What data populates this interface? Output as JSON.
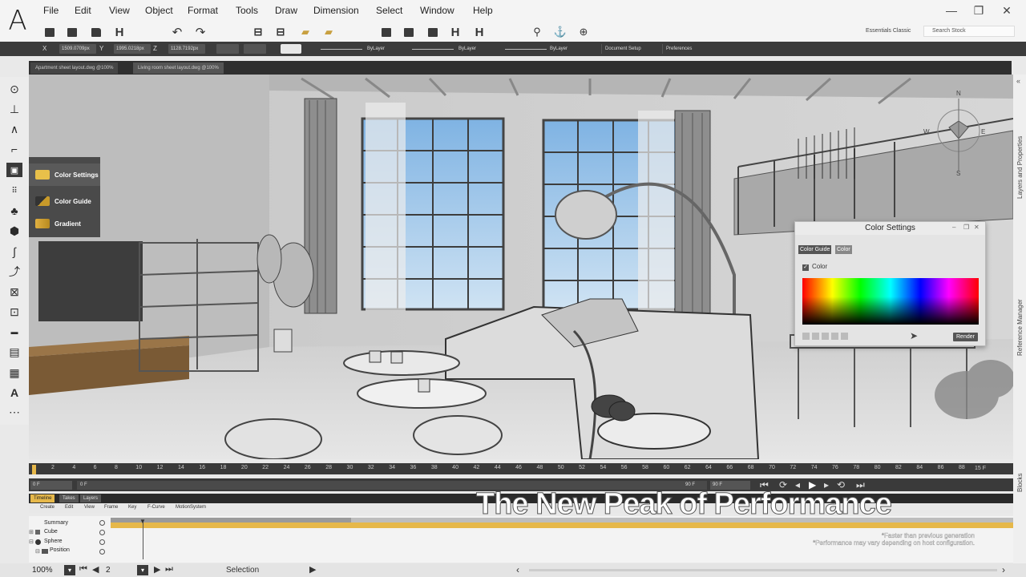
{
  "app": {
    "logo": "A"
  },
  "menu": [
    "File",
    "Edit",
    "View",
    "Object",
    "Format",
    "Tools",
    "Draw",
    "Dimension",
    "Select",
    "Window",
    "Help"
  ],
  "window_controls": {
    "minimize": "—",
    "restore": "❐",
    "close": "✕"
  },
  "toolbar": {
    "workspace": "Essentials Classic",
    "search_placeholder": "Search Stock"
  },
  "props": {
    "x_label": "X",
    "x_value": "1509.0709px",
    "y_label": "Y",
    "y_value": "1995.0218px",
    "z_label": "Z",
    "z_value": "1128.7192px",
    "layer1": "ByLayer",
    "layer2": "ByLayer",
    "layer3": "ByLayer",
    "doc_setup": "Document Setup",
    "preferences": "Preferences"
  },
  "tabs": [
    "Apartment sheet layout.dwg @100%",
    "Living room sheet layout.dwg @100%"
  ],
  "flyout": [
    {
      "label": "Color Settings",
      "color": "#e8c04a"
    },
    {
      "label": "Color Guide",
      "color": "#c89a2a"
    },
    {
      "label": "Gradient",
      "color": "#e0b040"
    }
  ],
  "right_tabs": {
    "layers": "Layers and Properties",
    "reference": "Reference Manager",
    "blocks": "Blocks"
  },
  "color_panel": {
    "title": "Color Settings",
    "tab1": "Color Guide",
    "tab2": "Color",
    "checkbox_label": "Color",
    "render": "Render"
  },
  "compass": {
    "n": "N",
    "e": "E",
    "s": "S",
    "w": "W"
  },
  "timeline": {
    "ticks": [
      "2",
      "4",
      "6",
      "8",
      "10",
      "12",
      "14",
      "16",
      "18",
      "20",
      "22",
      "24",
      "26",
      "28",
      "30",
      "32",
      "34",
      "36",
      "38",
      "40",
      "42",
      "44",
      "46",
      "48",
      "50",
      "52",
      "54",
      "56",
      "58",
      "60",
      "62",
      "64",
      "66",
      "68",
      "70",
      "72",
      "74",
      "76",
      "78",
      "80",
      "82",
      "84",
      "86",
      "88"
    ],
    "fps": "15 F",
    "start_frame": "0 F",
    "frame_left": "0 F",
    "frame_mid": "90 F",
    "frame_end": "90 F",
    "tabs": [
      "Timeline",
      "Takes",
      "Layers"
    ],
    "menus": [
      "Create",
      "Edit",
      "View",
      "Frame",
      "Key",
      "F-Curve",
      "MotionSystem"
    ],
    "rows": [
      "Summary",
      "Cube",
      "Sphere",
      "Position"
    ]
  },
  "status": {
    "zoom": "100%",
    "page": "2",
    "mode": "Selection"
  },
  "overlay": {
    "headline": "The New Peak of Performance",
    "disclaimer1": "*Faster than previous generation",
    "disclaimer2": "*Performance may vary depending on host configuration."
  },
  "colors": {
    "accent": "#e6b84a",
    "dark": "#3a3a3a"
  }
}
